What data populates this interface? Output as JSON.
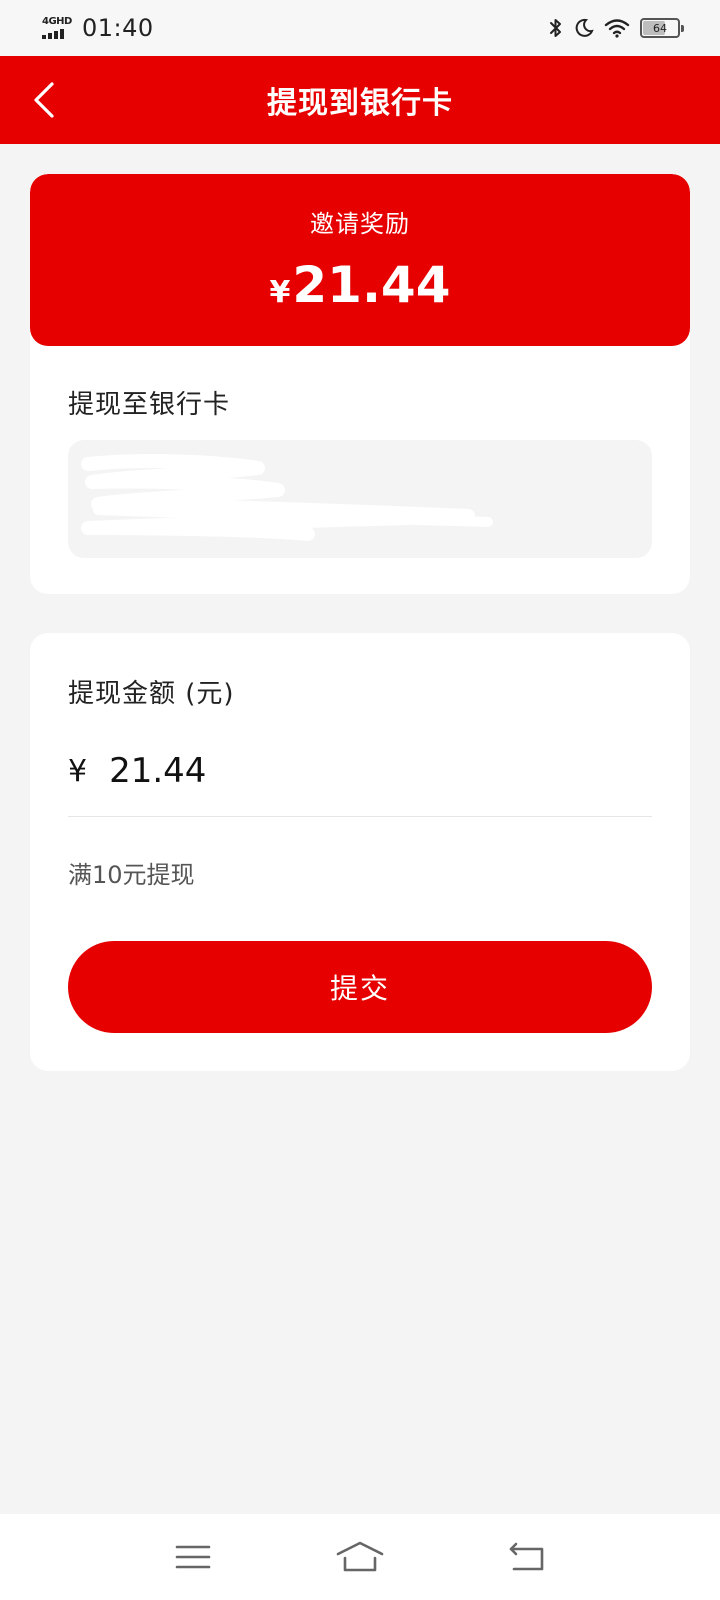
{
  "status_bar": {
    "network": "4GHD",
    "time": "01:40",
    "battery": "64"
  },
  "nav": {
    "title": "提现到银行卡"
  },
  "reward": {
    "label": "邀请奖励",
    "currency": "¥",
    "amount": "21.44"
  },
  "bank": {
    "label": "提现至银行卡"
  },
  "withdraw": {
    "label": "提现金额 (元)",
    "currency": "¥",
    "amount_value": "21.44",
    "hint": "满10元提现",
    "submit_label": "提交"
  },
  "colors": {
    "accent": "#e60000",
    "background": "#f4f4f4"
  },
  "icons": {
    "back": "chevron-left-icon",
    "menu": "menu-icon",
    "home": "home-icon",
    "return": "return-icon"
  }
}
